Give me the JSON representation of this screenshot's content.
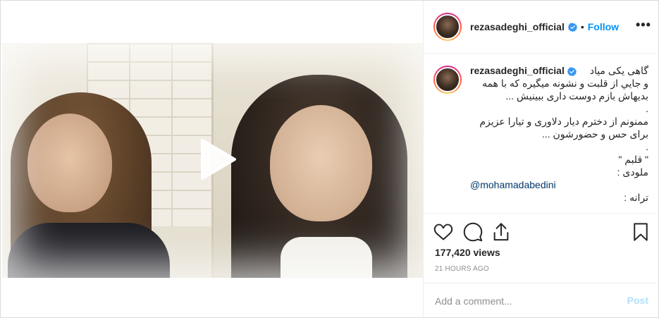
{
  "post": {
    "username": "rezasadeghi_official",
    "follow_label": "Follow",
    "dot": "•",
    "more_label": "•••",
    "caption_lines": [
      "گاهی یکی میاد",
      "و جايي از قلبت و نشونه میگیره که با همه",
      "بدیهاش بازم دوست داری ببینیش ...",
      ".",
      "ممنونم از دخترم دیار دلاوری و تیارا عزیزم",
      "برای حس و حضورشون ...",
      ".",
      "\" قلبم \"",
      "ملودی :",
      "@mohamadabedini",
      "ترانه :"
    ],
    "views": "177,420 views",
    "time": "21 HOURS AGO",
    "comment_placeholder": "Add a comment...",
    "post_label": "Post"
  },
  "colors": {
    "accent": "#0095f6",
    "verified": "#3897f0",
    "muted": "#8e8e8e",
    "post_disabled": "#b2dffc"
  }
}
